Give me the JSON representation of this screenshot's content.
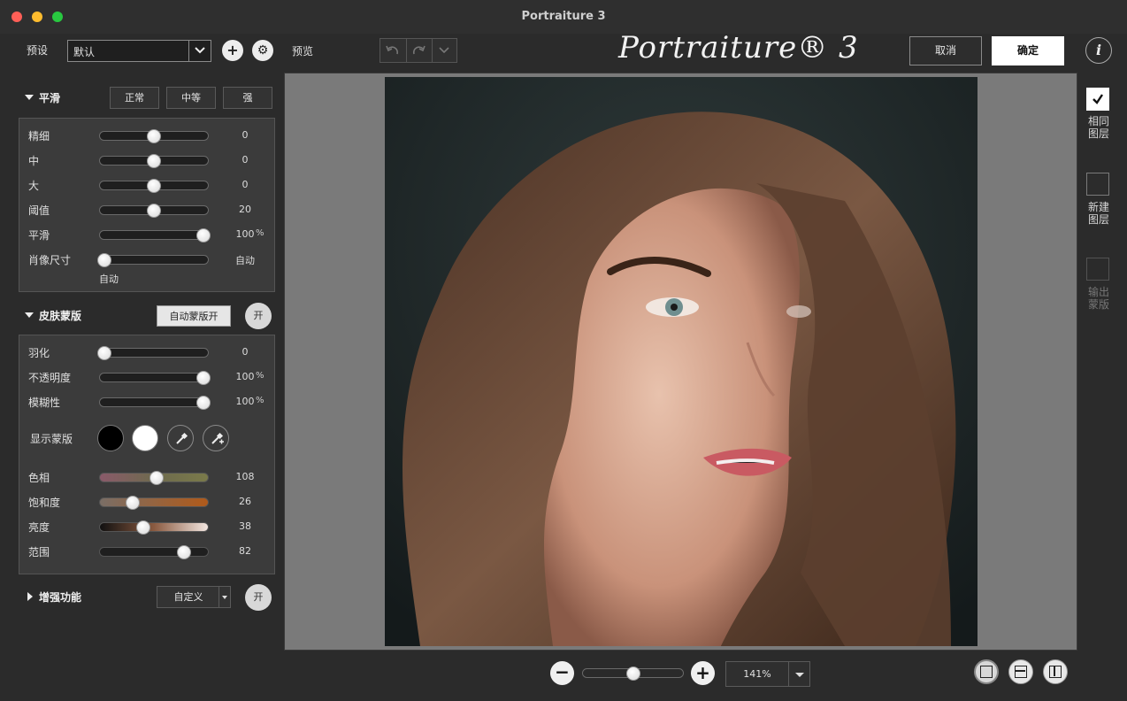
{
  "window": {
    "title": "Portraiture 3"
  },
  "presets": {
    "label": "预设",
    "selected": "默认"
  },
  "smoothing": {
    "title": "平滑",
    "buttons": [
      "正常",
      "中等",
      "强"
    ],
    "sliders": [
      {
        "label": "精细",
        "value": "0",
        "unit": "",
        "level": 0.5
      },
      {
        "label": "中",
        "value": "0",
        "unit": "",
        "level": 0.5
      },
      {
        "label": "大",
        "value": "0",
        "unit": "",
        "level": 0.5
      },
      {
        "label": "阈值",
        "value": "20",
        "unit": "",
        "level": 0.5
      },
      {
        "label": "平滑",
        "value": "100",
        "unit": "%",
        "level": 1.0
      },
      {
        "label": "肖像尺寸",
        "value": "自动",
        "unit": "",
        "level": 0.0
      }
    ],
    "portrait_size_sub": "自动"
  },
  "skin_mask": {
    "title": "皮肤蒙版",
    "auto_button": "自动蒙版开",
    "toggle": "开",
    "sliders": [
      {
        "label": "羽化",
        "value": "0",
        "unit": "",
        "level": 0.0
      },
      {
        "label": "不透明度",
        "value": "100",
        "unit": "%",
        "level": 1.0
      },
      {
        "label": "模糊性",
        "value": "100",
        "unit": "%",
        "level": 1.0
      }
    ],
    "show_mask_label": "显示蒙版",
    "color_sliders": [
      {
        "label": "色相",
        "value": "108",
        "level": 0.53
      },
      {
        "label": "饱和度",
        "value": "26",
        "level": 0.29
      },
      {
        "label": "亮度",
        "value": "38",
        "level": 0.39
      },
      {
        "label": "范围",
        "value": "82",
        "level": 0.8
      }
    ]
  },
  "enhancements": {
    "title": "增强功能",
    "selected": "自定义",
    "toggle": "开"
  },
  "toolbar": {
    "preview_label": "预览",
    "logo": "Portraiture® 3",
    "cancel": "取消",
    "ok": "确定",
    "info": "i"
  },
  "right_panel": {
    "same_layer": "相同\n图层",
    "new_layer": "新建\n图层",
    "output_mask": "输出\n蒙版"
  },
  "zoom": {
    "value": "141%",
    "level": 0.45
  },
  "colors": {
    "accent": "#ffffff",
    "canvas_bg": "#7a7a7a",
    "panel_bg": "#2b2b2b"
  }
}
